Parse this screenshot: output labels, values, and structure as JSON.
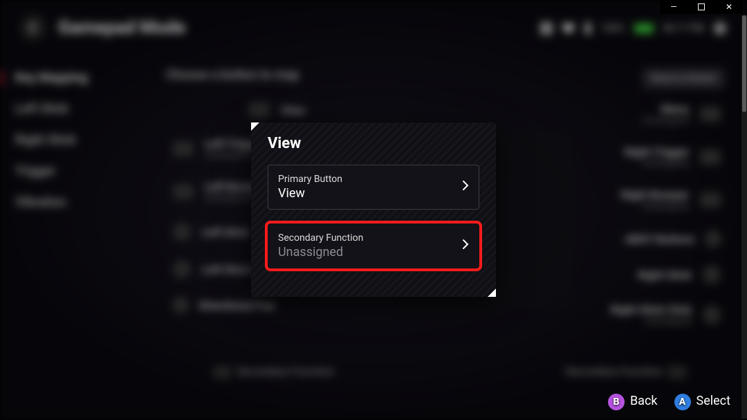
{
  "window": {
    "minimize": "—",
    "maximize": "□",
    "close": "✕"
  },
  "header": {
    "title": "Gamepad Mode"
  },
  "status": {
    "battery_pct": "100%",
    "time": "06:17 PM"
  },
  "sidebar": {
    "items": [
      {
        "label": "Key Mapping",
        "active": true
      },
      {
        "label": "Left Stick"
      },
      {
        "label": "Right Stick"
      },
      {
        "label": "Trigger"
      },
      {
        "label": "Vibration"
      }
    ]
  },
  "content": {
    "prompt": "Choose a button to map",
    "reset": "Reset to Default",
    "midtop": {
      "label": "View",
      "value": "View"
    },
    "left": [
      {
        "label": "Left Trigger",
        "value": "Unassigned"
      },
      {
        "label": "Left Bumper",
        "value": "Unassigned"
      },
      {
        "label": "Left Stick",
        "value": ""
      },
      {
        "label": "Left Stick Click",
        "value": ""
      },
      {
        "label": "Directional Pad",
        "value": ""
      }
    ],
    "right": [
      {
        "label": "Menu",
        "value": "Unassigned"
      },
      {
        "label": "Right Trigger",
        "value": "Unassigned"
      },
      {
        "label": "Right Bumper",
        "value": "Unassigned"
      },
      {
        "label": "ABXY Buttons",
        "value": ""
      },
      {
        "label": "Right Stick",
        "value": ""
      },
      {
        "label": "Right Stick Click",
        "value": "Unassigned"
      }
    ],
    "secondary_label": "Secondary Function"
  },
  "dialog": {
    "title": "View",
    "primary": {
      "label": "Primary Button",
      "value": "View"
    },
    "secondary": {
      "label": "Secondary Function",
      "value": "Unassigned"
    }
  },
  "hints": {
    "back": "Back",
    "select": "Select"
  }
}
